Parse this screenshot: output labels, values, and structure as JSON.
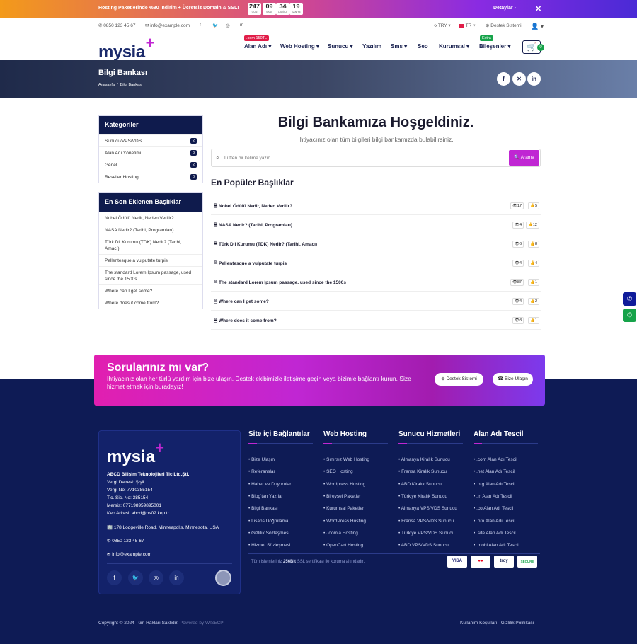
{
  "promo": {
    "text": "Hosting Paketlerinde %80 indirim + Ücretsiz Domain & SSL!",
    "countdown": [
      {
        "v": "247",
        "l": "GÜN"
      },
      {
        "v": "09",
        "l": "SAAT"
      },
      {
        "v": "34",
        "l": "DAKİKA"
      },
      {
        "v": "19",
        "l": "SANİYE"
      }
    ],
    "details": "Detaylar ›",
    "close": "✕"
  },
  "topbar": {
    "phone": "0850 123 45 67",
    "email": "info@example.com",
    "currency": "₺ TRY ▾",
    "lang": "TR ▾",
    "support": "Destek Sistemi"
  },
  "nav": {
    "logo": "mysia",
    "logo_plus": "+",
    "items": [
      "Alan Adı ▾",
      "Web Hosting ▾",
      "Sunucu ▾",
      "Yazılım",
      "Sms ▾",
      "Seo",
      "Kurumsal ▾",
      "Bileşenler ▾"
    ],
    "badge_domain": ".com 150TL",
    "badge_extra": "Extra",
    "cart_count": "0"
  },
  "banner": {
    "title": "Bilgi Bankası",
    "breadcrumb": "Anasayfa  /  Bilgi Bankası"
  },
  "categories": {
    "title": "Kategoriler",
    "items": [
      {
        "label": "Sunucu/VPS/VDS",
        "count": "2"
      },
      {
        "label": "Alan Adı Yönetimi",
        "count": "3"
      },
      {
        "label": "Genel",
        "count": "2"
      },
      {
        "label": "Reseller Hosting",
        "count": "0"
      }
    ]
  },
  "recent": {
    "title": "En Son Eklenen Başlıklar",
    "items": [
      "Nobel Ödülü Nedir, Neden Verilir?",
      "NASA Nedir? (Tarihi, Programları)",
      "Türk Dil Kurumu (TDK) Nedir? (Tarihi, Amacı)",
      "Pellentesque a vulputate turpis",
      "The standard Lorem Ipsum passage, used since the 1500s",
      "Where can I get some?",
      "Where does it come from?"
    ]
  },
  "main": {
    "welcome": "Bilgi Bankamıza Hoşgeldiniz.",
    "sub": "İhtiyacınız olan tüm bilgileri bilgi bankamızda bulabilirsiniz.",
    "search_placeholder": "Lütfen bir kelime yazın.",
    "search_btn": "🔍 Arama",
    "popular_title": "En Popüler Başlıklar",
    "popular": [
      {
        "t": "Nobel Ödülü Nedir, Neden Verilir?",
        "v": "17",
        "l": "5"
      },
      {
        "t": "NASA Nedir? (Tarihi, Programları)",
        "v": "4",
        "l": "12"
      },
      {
        "t": "Türk Dil Kurumu (TDK) Nedir? (Tarihi, Amacı)",
        "v": "6",
        "l": "8"
      },
      {
        "t": "Pellentesque a vulputate turpis",
        "v": "4",
        "l": "4"
      },
      {
        "t": "The standard Lorem Ipsum passage, used since the 1500s",
        "v": "87",
        "l": "1"
      },
      {
        "t": "Where can I get some?",
        "v": "4",
        "l": "2"
      },
      {
        "t": "Where does it come from?",
        "v": "3",
        "l": "1"
      }
    ]
  },
  "cta": {
    "title": "Sorularınız mı var?",
    "text": "İhtiyacınız olan her türlü yardım için bize ulaşın. Destek ekibimizle iletişime geçin veya bizimle bağlantı kurun. Size hizmet etmek için buradayız!",
    "btn1": "Destek Sistemi",
    "btn2": "Bize Ulaşın"
  },
  "footer": {
    "company": "ABCD Bilişim Teknolojileri Tic.Ltd.Şti.",
    "lines": [
      "Vergi Dairesi: Şişli",
      "Vergi No: 7710385154",
      "Tic. Sic. No: 385154",
      "Mersis: 077198959895001",
      "Kep Adresi: abcd@hs02.kep.tr"
    ],
    "address": "178 Lodgeville Road, Minneapolis, Minnesota, USA",
    "phone": "0850 123 45 67",
    "email": "info@example.com",
    "columns": [
      {
        "title": "Site içi Bağlantılar",
        "links": [
          "Bize Ulaşın",
          "Referanslar",
          "Haber ve Duyurular",
          "Blog'tan Yazılar",
          "Bilgi Bankası",
          "Lisans Doğrulama",
          "Gizlilik Sözleşmesi",
          "Hizmet Sözleşmesi"
        ]
      },
      {
        "title": "Web Hosting",
        "links": [
          "Sınırsız Web Hosting",
          "SEO Hosting",
          "Wordpress Hosting",
          "Bireysel Paketler",
          "Kurumsal Paketler",
          "WordPress Hosting",
          "Joomla Hosting",
          "OpenCart Hosting"
        ]
      },
      {
        "title": "Sunucu Hizmetleri",
        "links": [
          "Almanya Kiralık Sunucu",
          "Fransa Kiralık Sunucu",
          "ABD Kiralık Sunucu",
          "Türkiye Kiralık Sunucu",
          "Almanya VPS/VDS Sunucu",
          "Fransa VPS/VDS Sunucu",
          "Türkiye VPS/VDS Sunucu",
          "ABD VPS/VDS Sunucu"
        ]
      },
      {
        "title": "Alan Adı Tescil",
        "links": [
          ".com Alan Adı Tescil",
          ".net Alan Adı Tescil",
          ".org Alan Adı Tescil",
          ".in Alan Adı Tescil",
          ".co Alan Adı Tescil",
          ".pro Alan Adı Tescil",
          ".site Alan Adı Tescil",
          ".mobi Alan Adı Tescil"
        ]
      }
    ],
    "ssl_pre": "Tüm işlemleriniz ",
    "ssl_bold": "256Bit",
    "ssl_post": " SSL sertifikası ile koruma altındadır.",
    "cards": [
      "VISA",
      "●●",
      "troy",
      "SECURE"
    ],
    "copyright": "Copyright © 2024 Tüm Hakları Saklıdır.",
    "powered": " Powered by WISECP",
    "bottom_links": "Kullanım Koşulları   Gizlilik Politikası"
  }
}
